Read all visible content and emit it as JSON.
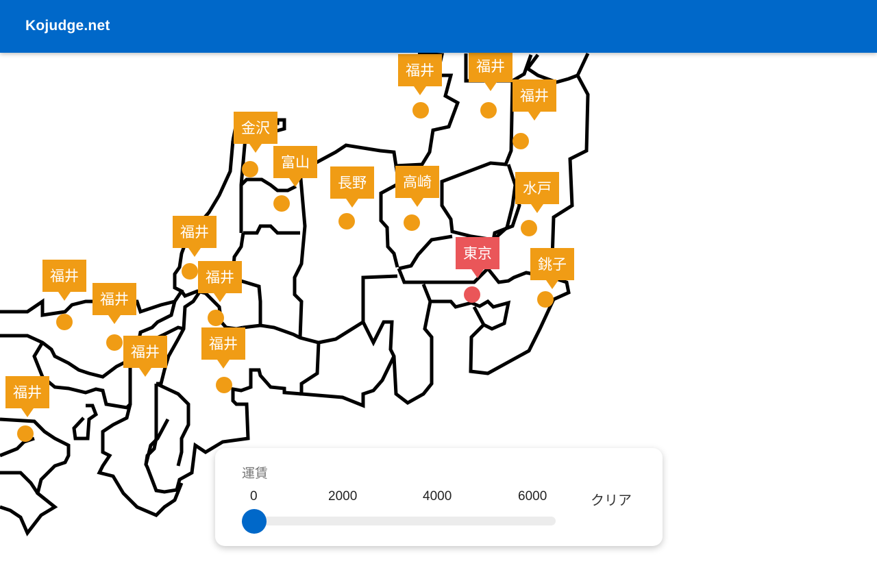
{
  "header": {
    "title": "Kojudge.net"
  },
  "colors": {
    "header_bg": "#0068c9",
    "marker": "#f09c15",
    "origin_marker": "#ea5659",
    "slider": "#0068c9"
  },
  "map": {
    "markers": [
      {
        "label": "福井",
        "type": "station"
      },
      {
        "label": "福井",
        "type": "station"
      },
      {
        "label": "福井",
        "type": "station"
      },
      {
        "label": "金沢",
        "type": "station"
      },
      {
        "label": "富山",
        "type": "station"
      },
      {
        "label": "長野",
        "type": "station"
      },
      {
        "label": "高崎",
        "type": "station"
      },
      {
        "label": "水戸",
        "type": "station"
      },
      {
        "label": "東京",
        "type": "origin"
      },
      {
        "label": "銚子",
        "type": "station"
      },
      {
        "label": "福井",
        "type": "station"
      },
      {
        "label": "福井",
        "type": "station"
      },
      {
        "label": "福井",
        "type": "station"
      },
      {
        "label": "福井",
        "type": "station"
      },
      {
        "label": "福井",
        "type": "station"
      },
      {
        "label": "福井",
        "type": "station"
      },
      {
        "label": "福井",
        "type": "station"
      }
    ]
  },
  "fare_panel": {
    "title": "運賃",
    "ticks": [
      "0",
      "2000",
      "4000",
      "6000"
    ],
    "clear_label": "クリア",
    "value": 0,
    "min": 0,
    "max": 6000
  }
}
